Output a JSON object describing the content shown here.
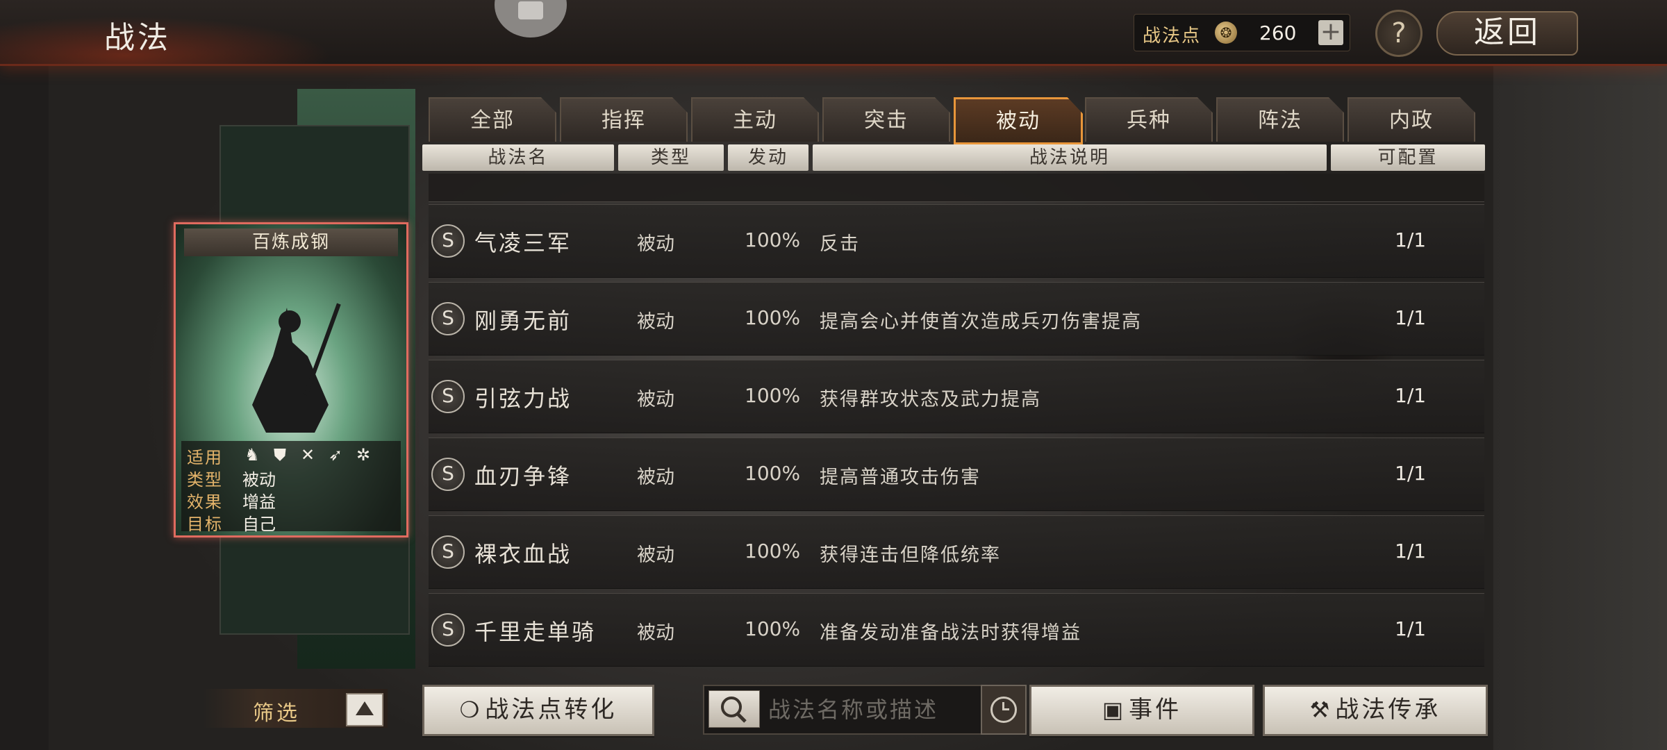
{
  "header": {
    "title": "战法",
    "points_label": "战法点",
    "points_value": "260",
    "plus_label": "+",
    "help_label": "?",
    "back_label": "返回"
  },
  "card": {
    "name": "百炼成钢",
    "info": {
      "apply_key": "适用",
      "type_key": "类型",
      "type_val": "被动",
      "effect_key": "效果",
      "effect_val": "增益",
      "target_key": "目标",
      "target_val": "自己"
    },
    "apply_icons": [
      "cavalry-icon",
      "shield-icon",
      "bow-icon",
      "spear-icon",
      "wheel-icon"
    ]
  },
  "tabs": [
    "全部",
    "指挥",
    "主动",
    "突击",
    "被动",
    "兵种",
    "阵法",
    "内政"
  ],
  "active_tab": "被动",
  "columns": {
    "name": "战法名",
    "type": "类型",
    "rate": "发动",
    "desc": "战法说明",
    "count": "可配置"
  },
  "rows": [
    {
      "badge": "S",
      "name": "气凌三军",
      "type": "被动",
      "rate": "100%",
      "desc": "反击",
      "count": "1/1"
    },
    {
      "badge": "S",
      "name": "刚勇无前",
      "type": "被动",
      "rate": "100%",
      "desc": "提高会心并使首次造成兵刃伤害提高",
      "count": "1/1"
    },
    {
      "badge": "S",
      "name": "引弦力战",
      "type": "被动",
      "rate": "100%",
      "desc": "获得群攻状态及武力提高",
      "count": "1/1"
    },
    {
      "badge": "S",
      "name": "血刃争锋",
      "type": "被动",
      "rate": "100%",
      "desc": "提高普通攻击伤害",
      "count": "1/1"
    },
    {
      "badge": "S",
      "name": "裸衣血战",
      "type": "被动",
      "rate": "100%",
      "desc": "获得连击但降低统率",
      "count": "1/1"
    },
    {
      "badge": "S",
      "name": "千里走单骑",
      "type": "被动",
      "rate": "100%",
      "desc": "准备发动准备战法时获得增益",
      "count": "1/1"
    }
  ],
  "bottom": {
    "filter_label": "筛选",
    "convert_label": "战法点转化",
    "search_placeholder": "战法名称或描述",
    "event_label": "事件",
    "inherit_label": "战法传承"
  },
  "colors": {
    "accent": "#e8963a",
    "card_border": "#e06b5f",
    "gold_text": "#e8c887"
  }
}
